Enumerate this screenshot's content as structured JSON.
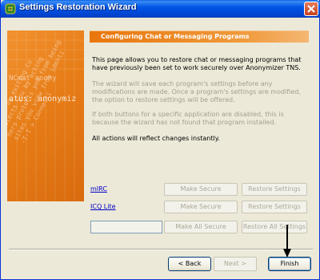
{
  "window": {
    "title": "Settings Restoration Wizard"
  },
  "side_panel": {
    "watermark_lines": [
      "NCmat anony",
      "atus: anonymiz"
    ],
    "rotated_text": [
      "...sed by exiting Co",
      "protects you by acting",
      "hers protects you from being",
      "   sites you view from identi",
      "  -T-T > Connecti"
    ]
  },
  "header": {
    "title": "Configuring Chat or Messaging Programs"
  },
  "paragraphs": {
    "intro": "This page allows you to restore chat or messaging programs that have previously been set to work securely over Anonymizer TNS.",
    "save_note": "The wizard will save each program's settings before any modifications are made. Once a program's settings are modified, the option to restore settings will be offered.",
    "disabled_note": "If both buttons for a specific application are disabled, this is because the wizard has not found that program installed.",
    "instant_note": "All actions will reflect changes instantly."
  },
  "programs": [
    {
      "name": "mIRC",
      "make_secure": "Make Secure",
      "restore": "Restore Settings"
    },
    {
      "name": "ICQ Lite",
      "make_secure": "Make Secure",
      "restore": "Restore Settings"
    }
  ],
  "all_actions": {
    "make_all_secure": "Make All Secure",
    "restore_all": "Restore All Settings"
  },
  "footer": {
    "back": "< Back",
    "next": "Next >",
    "finish": "Finish"
  },
  "colors": {
    "accent_orange": "#e8760c",
    "titlebar_blue": "#0055e5",
    "link_blue": "#0000c8"
  }
}
